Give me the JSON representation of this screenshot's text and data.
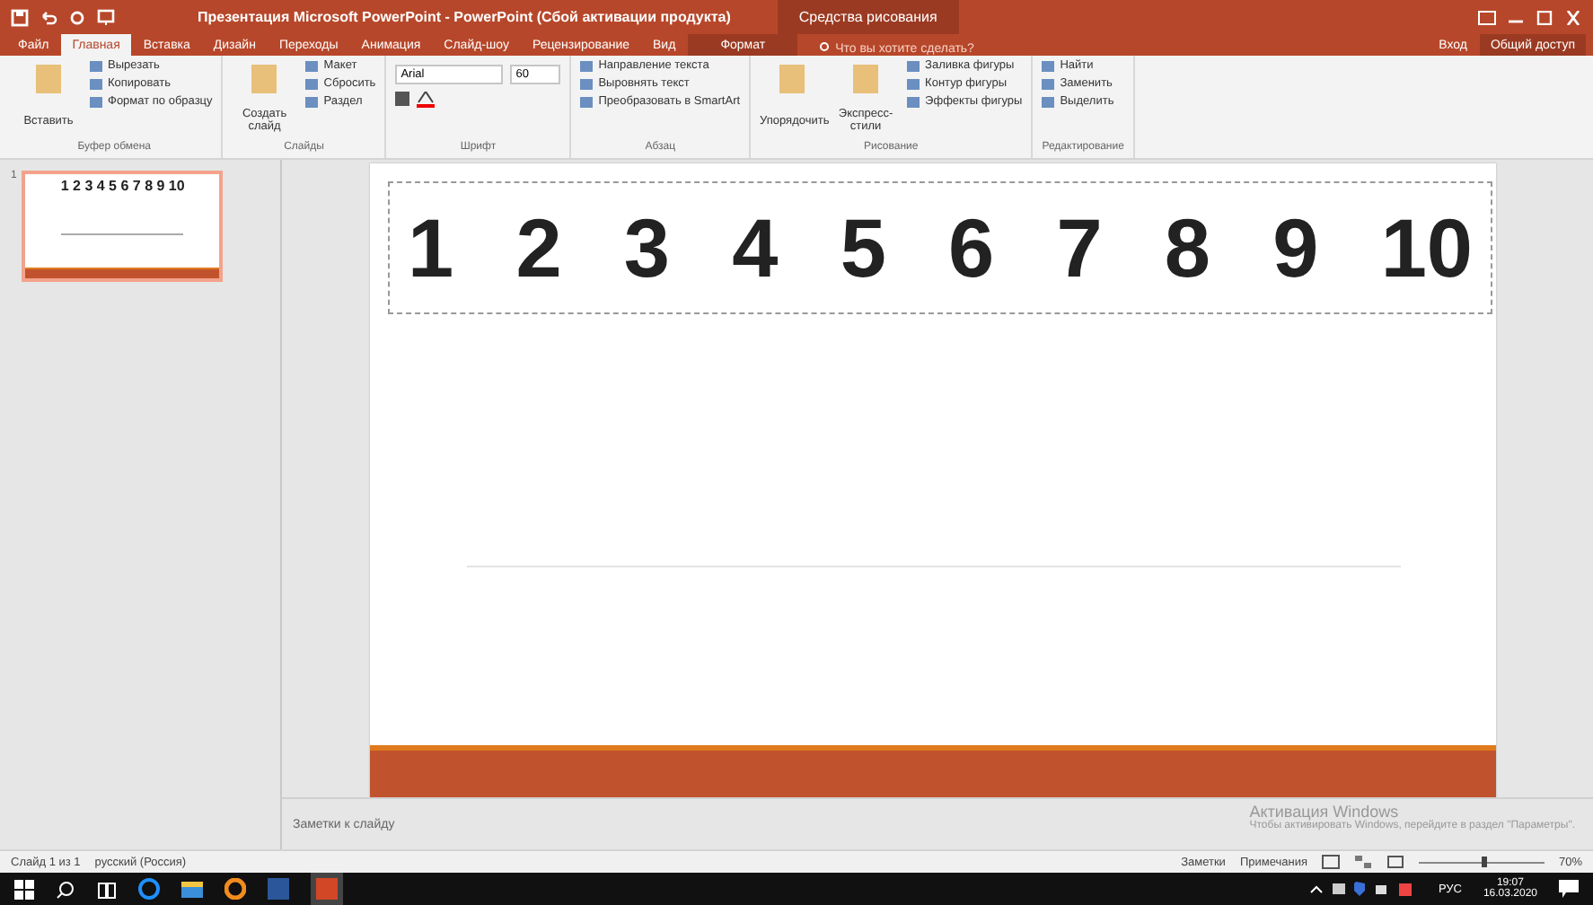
{
  "title_bar": {
    "title": "Презентация Microsoft PowerPoint - PowerPoint (Сбой активации продукта)",
    "context_group": "Средства рисования"
  },
  "tabs": [
    {
      "label": "Файл",
      "selected": false
    },
    {
      "label": "Главная",
      "selected": true
    },
    {
      "label": "Вставка",
      "selected": false
    },
    {
      "label": "Дизайн",
      "selected": false
    },
    {
      "label": "Переходы",
      "selected": false
    },
    {
      "label": "Анимация",
      "selected": false
    },
    {
      "label": "Слайд-шоу",
      "selected": false
    },
    {
      "label": "Рецензирование",
      "selected": false
    },
    {
      "label": "Вид",
      "selected": false
    },
    {
      "label": "Формат",
      "selected": false
    }
  ],
  "tell_me": {
    "placeholder": "Что вы хотите сделать?"
  },
  "sign_in": "Вход",
  "share": "Общий доступ",
  "ribbon": [
    {
      "label": "Буфер обмена",
      "big": "Вставить",
      "items": [
        "Вырезать",
        "Копировать",
        "Формат по образцу"
      ]
    },
    {
      "label": "Слайды",
      "big": "Создать слайд",
      "items": [
        "Макет",
        "Сбросить",
        "Раздел"
      ]
    },
    {
      "label": "Шрифт",
      "font": "Arial",
      "size": "60"
    },
    {
      "label": "Абзац",
      "items": [
        "Направление текста",
        "Выровнять текст",
        "Преобразовать в SmartArt"
      ]
    },
    {
      "label": "Рисование",
      "big": "Упорядочить",
      "big2": "Экспресс-стили",
      "items": [
        "Заливка фигуры",
        "Контур фигуры",
        "Эффекты фигуры"
      ]
    },
    {
      "label": "Редактирование",
      "items": [
        "Найти",
        "Заменить",
        "Выделить"
      ]
    }
  ],
  "thumbnails": [
    {
      "number": "1",
      "text": "1 2 3 4 5 6 7 8 9 10",
      "selected": true
    }
  ],
  "slide": {
    "numbers": [
      "1",
      "2",
      "3",
      "4",
      "5",
      "6",
      "7",
      "8",
      "9",
      "10"
    ],
    "selected": true
  },
  "notes": {
    "placeholder": "Заметки к слайду"
  },
  "activation": {
    "title": "Активация Windows",
    "message": "Чтобы активировать Windows, перейдите в раздел \"Параметры\"."
  },
  "status_bar": {
    "slide_info": "Слайд 1 из 1",
    "language": "русский (Россия)",
    "notes": "Заметки",
    "comments": "Примечания",
    "zoom": "70%",
    "level": 0.55
  },
  "taskbar": {
    "language": "РУС",
    "time": "19:07",
    "date": "16.03.2020"
  }
}
